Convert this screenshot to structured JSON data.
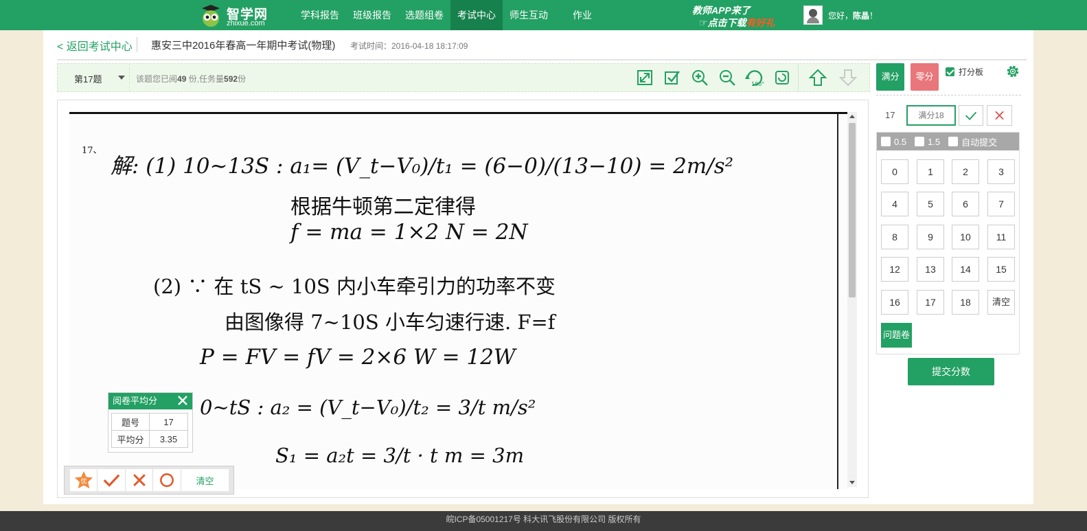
{
  "nav": {
    "logo": {
      "brand": "智学网",
      "domain": "zhixue.com"
    },
    "items": [
      "学科报告",
      "班级报告",
      "选题组卷",
      "考试中心",
      "师生互动",
      "作业"
    ],
    "active_index": 3,
    "promo": {
      "line1": "教师APP来了",
      "line2_prefix": "点击下载",
      "line2_highlight": "有好礼"
    },
    "user": {
      "greeting": "您好，",
      "name": "陈晶",
      "suffix": "！"
    }
  },
  "exam": {
    "back_label": "< 返回考试中心",
    "title": "惠安三中2016年春高一年期中考试(物理)",
    "time_label": "考试时间：2016-04-18 18:17:09"
  },
  "toolbar": {
    "question_label": "第17题",
    "read_prefix": "该题您已阅",
    "read_count": "49",
    "read_mid": " 份,任务量",
    "task_count": "592",
    "task_suffix": "份",
    "tool_icons": [
      "expand-icon",
      "check-square-icon",
      "zoom-in-icon",
      "zoom-out-icon",
      "rotate-180-icon",
      "rotate-icon",
      "arrow-up-icon",
      "arrow-down-icon"
    ],
    "rotate_label": "180°"
  },
  "right_panel": {
    "full_label": "满分",
    "zero_label": "零分",
    "board_label": "打分板",
    "board_checked": true,
    "question_no": "17",
    "score_placeholder": "满分18",
    "options": [
      "0.5",
      "1.5",
      "自动提交"
    ],
    "keys": [
      "0",
      "1",
      "2",
      "3",
      "4",
      "5",
      "6",
      "7",
      "8",
      "9",
      "10",
      "11",
      "12",
      "13",
      "14",
      "15",
      "16",
      "17",
      "18",
      "清空"
    ],
    "problem_label": "问题卷",
    "submit_label": "提交分数"
  },
  "answer_sheet": {
    "q_no": "17、",
    "lines": [
      "解: (1) 10~13S :  a₁= (V_t−V₀)/t₁ = (6−0)/(13−10) = 2m/s²",
      "根据牛顿第二定律得",
      "f = ma = 1×2 N = 2N",
      "(2) ∵ 在 tS ~ 10S 内小车牵引力的功率不变",
      "由图像得 7~10S 小车匀速行速. F=f",
      "P = FV = fV = 2×6 W = 12W",
      "0~tS :  a₂ = (V_t−V₀)/t₂ = 3/t m/s²",
      "S₁ = a₂t = 3/t · t m = 3m"
    ]
  },
  "avg_popup": {
    "title": "阅卷平均分",
    "rows": [
      {
        "key": "题号",
        "value": "17"
      },
      {
        "key": "平均分",
        "value": "3.35"
      }
    ]
  },
  "marks": {
    "icons": [
      "excellent-star-icon",
      "tick-icon",
      "cross-icon",
      "circle-icon"
    ],
    "excellent_label": "优",
    "clear_label": "清空"
  },
  "footer": {
    "text": "皖ICP备05001217号 科大讯飞股份有限公司 版权所有"
  },
  "colors": {
    "brand": "#23a063",
    "brand_dark": "#17814d",
    "zero": "#e8767a",
    "page_bg": "#f3ecd9"
  }
}
